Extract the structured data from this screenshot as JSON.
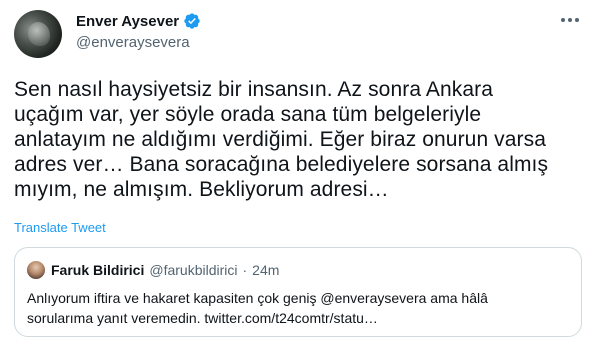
{
  "author": {
    "display_name": "Enver Aysever",
    "handle": "@enveraysevera",
    "verified": true
  },
  "tweet": {
    "lines": [
      "Sen nasıl haysiyetsiz bir insansın. Az sonra Ankara",
      "uçağım var, yer söyle orada sana tüm belgeleriyle",
      "anlatayım ne aldığımı verdiğimi. Eğer biraz onurun varsa",
      "adres ver… Bana soracağına belediyelere sorsana almış",
      "mıyım, ne almışım. Bekliyorum adresi…"
    ],
    "translate_label": "Translate Tweet"
  },
  "quoted": {
    "display_name": "Faruk Bildirici",
    "handle": "@farukbildirici",
    "separator": "·",
    "time": "24m",
    "lines": [
      "Anlıyorum iftira ve hakaret kapasiten çok geniş @enveraysevera ama hâlâ",
      "sorularıma yanıt veremedin. twitter.com/t24comtr/statu…"
    ]
  },
  "icons": {
    "verified": "verified-badge-icon",
    "more": "more-options-icon"
  },
  "colors": {
    "accent": "#1d9bf0",
    "text": "#0f1419",
    "secondary": "#536471",
    "border": "#cfd9de"
  }
}
